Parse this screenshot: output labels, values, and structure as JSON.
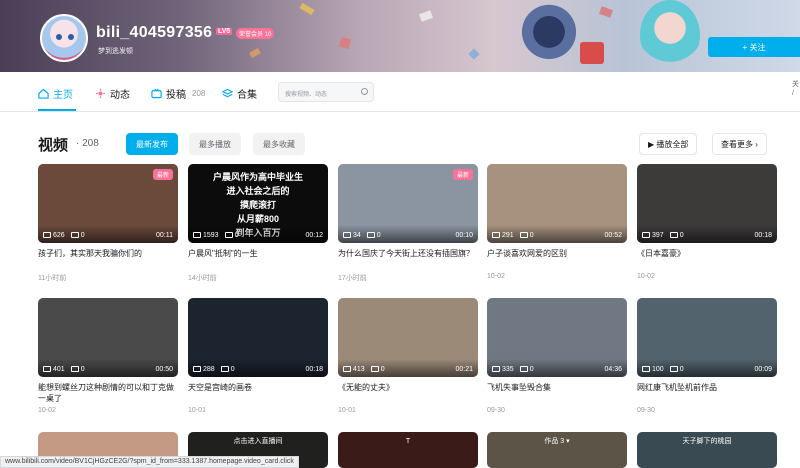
{
  "profile": {
    "username": "bili_404597356",
    "level_badge": "LV5",
    "vip_badge": "荣誉会员 10",
    "sign": "梦到逃发顿",
    "follow_label": "+ 关注"
  },
  "tabs": [
    {
      "label": "主页",
      "icon": "home-icon"
    },
    {
      "label": "动态",
      "icon": "activity-icon"
    },
    {
      "label": "投稿",
      "icon": "tv-icon",
      "count": "208"
    },
    {
      "label": "合集",
      "icon": "stack-icon"
    }
  ],
  "search": {
    "placeholder": "搜索视频、动态"
  },
  "edge_text": "关\n/",
  "section": {
    "title": "视频",
    "count": "· 208",
    "sorts": [
      "最新发布",
      "最多播放",
      "最多收藏"
    ],
    "play_all": "▶ 播放全部",
    "see_more": "查看更多 ›"
  },
  "videos": [
    {
      "title": "孩子们，其实那天我骗你们的",
      "time": "11小时前",
      "plays": "626",
      "danmaku": "0",
      "duration": "00:11",
      "badge": "最新",
      "thumb_color": "#6b4a3c"
    },
    {
      "title": "户晨风\"抵制\"的一生",
      "time": "14小时前",
      "plays": "1593",
      "danmaku": "0",
      "duration": "00:12",
      "badge": "",
      "thumb_color": "#0c0c0c",
      "overlay_text": "户晨风作为高中毕业生\n进入社会之后的\n摸爬滚打\n从月薪800\n到年入百万"
    },
    {
      "title": "为什么国庆了今天街上还没有插国旗？",
      "time": "17小时前",
      "plays": "34",
      "danmaku": "0",
      "duration": "00:10",
      "badge": "最新",
      "thumb_color": "#8b95a2"
    },
    {
      "title": "户子谈喜欢网爱的区别",
      "time": "10-02",
      "plays": "291",
      "danmaku": "0",
      "duration": "00:52",
      "badge": "",
      "thumb_color": "#a6927f"
    },
    {
      "title": "《日本嘉豪》",
      "time": "10-02",
      "plays": "397",
      "danmaku": "0",
      "duration": "00:18",
      "badge": "",
      "thumb_color": "#3d3b3a"
    },
    {
      "title": "能想到螺丝刀这种剧情的可以和丁克做一桌了",
      "time": "10-02",
      "plays": "401",
      "danmaku": "0",
      "duration": "00:50",
      "badge": "",
      "thumb_color": "#4a4a4a"
    },
    {
      "title": "天空是宫崎的画卷",
      "time": "10-01",
      "plays": "288",
      "danmaku": "0",
      "duration": "00:18",
      "badge": "",
      "thumb_color": "#1c2430"
    },
    {
      "title": "《无能的丈夫》",
      "time": "10-01",
      "plays": "413",
      "danmaku": "0",
      "duration": "00:21",
      "badge": "",
      "thumb_color": "#9c8a79"
    },
    {
      "title": "飞机失事坠毁合集",
      "time": "09-30",
      "plays": "335",
      "danmaku": "0",
      "duration": "04:36",
      "badge": "",
      "thumb_color": "#6f7883"
    },
    {
      "title": "网红康飞机坠机前作品",
      "time": "09-30",
      "plays": "100",
      "danmaku": "0",
      "duration": "00:09",
      "badge": "",
      "thumb_color": "#52636e"
    }
  ],
  "bottom_row": [
    {
      "thumb_color": "#c49a84"
    },
    {
      "thumb_color": "#20201f",
      "overlay_text": "点击进入直播间"
    },
    {
      "thumb_color": "#3b1b18",
      "overlay_text": "T"
    },
    {
      "thumb_color": "#5d5448",
      "overlay_text": "作品 3 ▾"
    },
    {
      "thumb_color": "#3a4a52",
      "overlay_text": "天子脚下的桃园"
    }
  ],
  "status_url": "www.bilibili.com/video/BV1CjHGzCE2G/?spm_id_from=333.1387.homepage.video_card.click",
  "colors": {
    "accent": "#00aeec",
    "pink": "#fb7299"
  }
}
